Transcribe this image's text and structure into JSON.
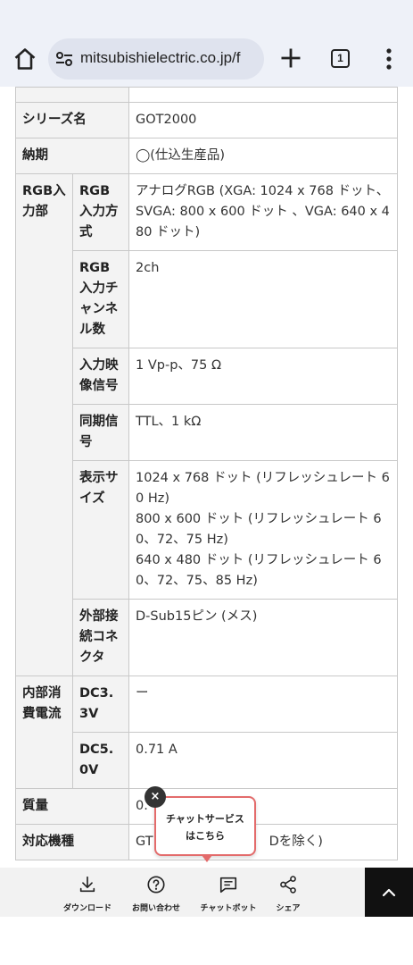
{
  "browser": {
    "url": "mitsubishielectric.co.jp/f",
    "tab_count": "1"
  },
  "spec": {
    "series_label": "シリーズ名",
    "series_value": "GOT2000",
    "delivery_label": "納期",
    "delivery_value": "◯(仕込生産品)",
    "rgb_group": "RGB入力部",
    "rgb_method_label": "RGB入力方式",
    "rgb_method_value": "アナログRGB (XGA: 1024 x 768 ドット、SVGA: 800 x 600 ドット 、VGA: 640 x 480 ドット)",
    "rgb_channels_label": "RGB入力チャンネル数",
    "rgb_channels_value": "2ch",
    "video_signal_label": "入力映像信号",
    "video_signal_value": "1 Vp-p、75 Ω",
    "sync_label": "同期信号",
    "sync_value": "TTL、1 kΩ",
    "display_size_label": "表示サイズ",
    "display_size_line1": "1024 x 768 ドット (リフレッシュレート 60 Hz)",
    "display_size_line2": "800 x 600 ドット (リフレッシュレート 60、72、75 Hz)",
    "display_size_line3": "640 x 480 ドット (リフレッシュレート 60、72、75、85 Hz)",
    "connector_label": "外部接続コネクタ",
    "connector_value": "D-Sub15ピン (メス)",
    "current_group": "内部消費電流",
    "dc33_label": "DC3.3V",
    "dc33_value": "ー",
    "dc50_label": "DC5.0V",
    "dc50_value": "0.71 A",
    "mass_label": "質量",
    "mass_value": "0.",
    "models_label": "対応機種",
    "models_value_start": "GT",
    "models_value_end": "Dを除く)"
  },
  "chat_popup": {
    "line1": "チャットサービス",
    "line2": "はこちら",
    "close": "×"
  },
  "bottom_bar": {
    "download": "ダウンロード",
    "inquiry": "お問い合わせ",
    "chatbot": "チャットボット",
    "share": "シェア"
  }
}
